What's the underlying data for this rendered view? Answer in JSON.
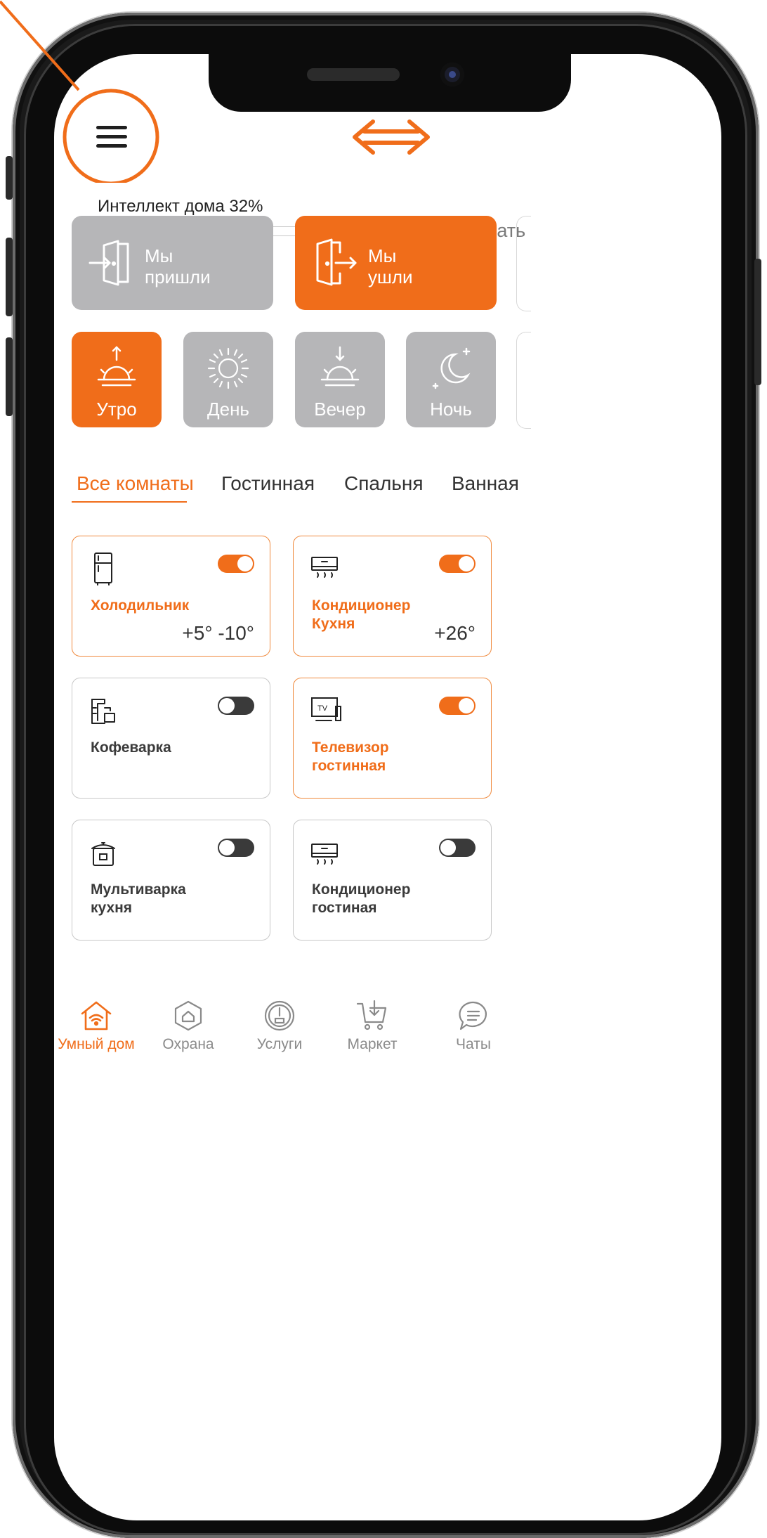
{
  "colors": {
    "accent": "#f06d1a",
    "inactive_card": "#b6b6b8",
    "toggle_off": "#3a3a3a"
  },
  "header": {
    "menu_icon": "hamburger-menu-icon",
    "logo_icon": "double-arrow-logo-icon"
  },
  "intellect": {
    "label": "Интеллект дома 32%",
    "progress": 0.32,
    "action": "Прокачать"
  },
  "scenarios": [
    {
      "label": "Мы\nпришли",
      "icon": "door-enter-icon",
      "active": false
    },
    {
      "label": "Мы\nушли",
      "icon": "door-exit-icon",
      "active": true
    }
  ],
  "times_of_day": [
    {
      "label": "Утро",
      "icon": "sunrise-icon",
      "active": true
    },
    {
      "label": "День",
      "icon": "sun-icon",
      "active": false
    },
    {
      "label": "Вечер",
      "icon": "sunset-icon",
      "active": false
    },
    {
      "label": "Ночь",
      "icon": "moon-icon",
      "active": false
    }
  ],
  "rooms": {
    "tabs": [
      {
        "label": "Все комнаты",
        "active": true
      },
      {
        "label": "Гостинная",
        "active": false
      },
      {
        "label": "Спальня",
        "active": false
      },
      {
        "label": "Ванная",
        "active": false
      }
    ]
  },
  "devices": [
    {
      "name": "Холодильник",
      "value": "+5° -10°",
      "on": true,
      "icon": "fridge-icon"
    },
    {
      "name": "Кондиционер\nКухня",
      "value": "+26°",
      "on": true,
      "icon": "air-conditioner-icon"
    },
    {
      "name": "Кофеварка",
      "value": "",
      "on": false,
      "icon": "coffee-maker-icon"
    },
    {
      "name": "Телевизор\nгостинная",
      "value": "",
      "on": true,
      "icon": "tv-icon"
    },
    {
      "name": "Мультиварка\nкухня",
      "value": "",
      "on": false,
      "icon": "multicooker-icon"
    },
    {
      "name": "Кондиционер\nгостиная",
      "value": "",
      "on": false,
      "icon": "air-conditioner-icon"
    }
  ],
  "nav": [
    {
      "label": "Умный дом",
      "icon": "smart-home-icon",
      "active": true
    },
    {
      "label": "Охрана",
      "icon": "security-shield-icon",
      "active": false
    },
    {
      "label": "Услуги",
      "icon": "services-gauge-icon",
      "active": false
    },
    {
      "label": "Маркет",
      "icon": "cart-icon",
      "active": false
    },
    {
      "label": "Чаты",
      "icon": "chat-icon",
      "active": false
    }
  ]
}
